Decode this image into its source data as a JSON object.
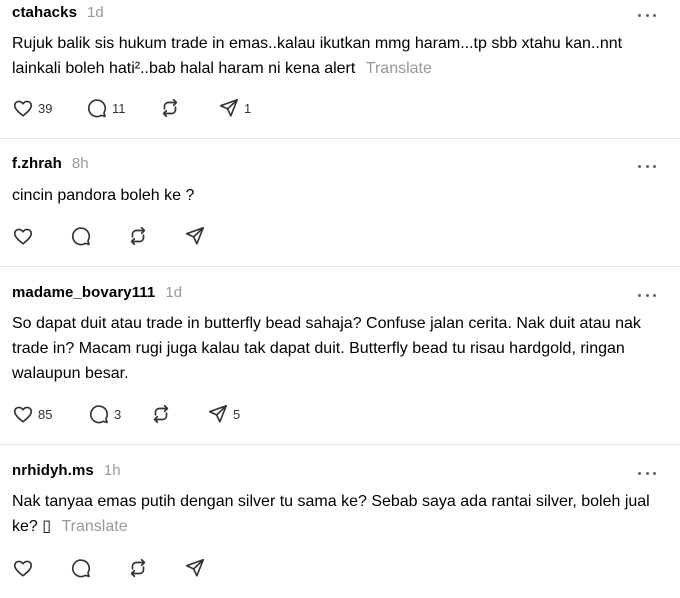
{
  "posts": [
    {
      "username": "ctahacks",
      "time": "1d",
      "text": "Rujuk balik sis hukum trade in emas..kalau ikutkan mmg haram...tp sbb xtahu kan..nnt lainkali boleh hati²..bab halal haram ni kena alert",
      "translate": "Translate",
      "likes": "39",
      "replies": "11",
      "reposts": "",
      "shares": "1"
    },
    {
      "username": "f.zhrah",
      "time": "8h",
      "text": "cincin pandora boleh ke ?",
      "translate": "",
      "likes": "",
      "replies": "",
      "reposts": "",
      "shares": ""
    },
    {
      "username": "madame_bovary111",
      "time": "1d",
      "text": "So dapat duit atau trade in butterfly bead sahaja? Confuse jalan cerita. Nak duit atau nak trade in? Macam rugi juga kalau tak dapat duit. Butterfly bead tu risau hardgold, ringan walaupun besar.",
      "translate": "",
      "likes": "85",
      "replies": "3",
      "reposts": "",
      "shares": "5"
    },
    {
      "username": "nrhidyh.ms",
      "time": "1h",
      "text": "Nak tanyaa emas putih dengan silver tu sama ke? Sebab saya ada rantai silver, boleh jual ke? ▯",
      "translate": "Translate",
      "likes": "",
      "replies": "",
      "reposts": "",
      "shares": ""
    }
  ],
  "icons": {
    "like": "heart-icon",
    "reply": "comment-icon",
    "repost": "repost-icon",
    "share": "send-icon",
    "more": "more-options-icon"
  },
  "colors": {
    "text": "#000000",
    "muted": "#999999",
    "icon": "#333333",
    "divider": "#e5e5e5"
  }
}
